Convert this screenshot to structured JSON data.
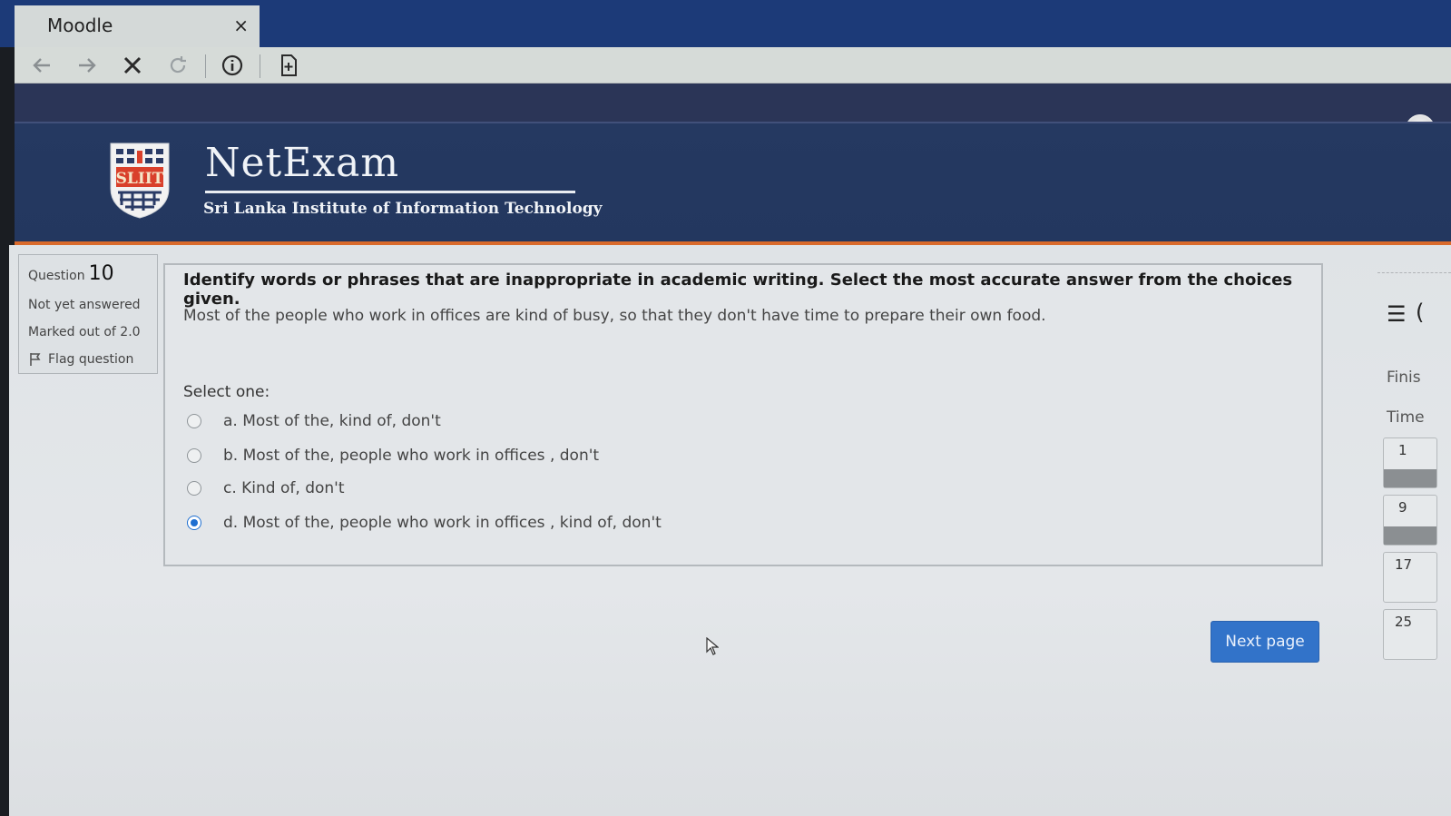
{
  "browser": {
    "tab_title": "Moodle",
    "tab_close": "×"
  },
  "header": {
    "site_title": "NetExam",
    "institute": "Sri Lanka Institute of Information Technology",
    "logo_text": "SLIIT"
  },
  "question_info": {
    "question_label": "Question",
    "question_number": "10",
    "state": "Not yet answered",
    "marks": "Marked out of 2.0",
    "flag_label": "Flag question"
  },
  "question": {
    "instruction": "Identify words or phrases that are inappropriate in academic writing. Select the most accurate answer from the choices given.",
    "sentence": "Most of the people who work in offices are kind of busy, so that they don't have time to prepare their own food.",
    "select_label": "Select one:",
    "options": [
      {
        "label": "a. Most of the, kind of, don't",
        "selected": false
      },
      {
        "label": "b. Most of the, people who work in offices , don't",
        "selected": false
      },
      {
        "label": "c. Kind of, don't",
        "selected": false
      },
      {
        "label": "d. Most of the, people who work in offices , kind of, don't",
        "selected": true
      }
    ]
  },
  "actions": {
    "next_page": "Next page"
  },
  "side_nav": {
    "finish_label": "Finis",
    "time_label": "Time",
    "buttons": [
      {
        "number": "1",
        "answered": true
      },
      {
        "number": "9",
        "answered": true
      },
      {
        "number": "17",
        "answered": false
      },
      {
        "number": "25",
        "answered": false
      }
    ]
  },
  "colors": {
    "header_bg": "#23375f",
    "accent_orange": "#d96a2b",
    "primary_button": "#3273c9"
  }
}
